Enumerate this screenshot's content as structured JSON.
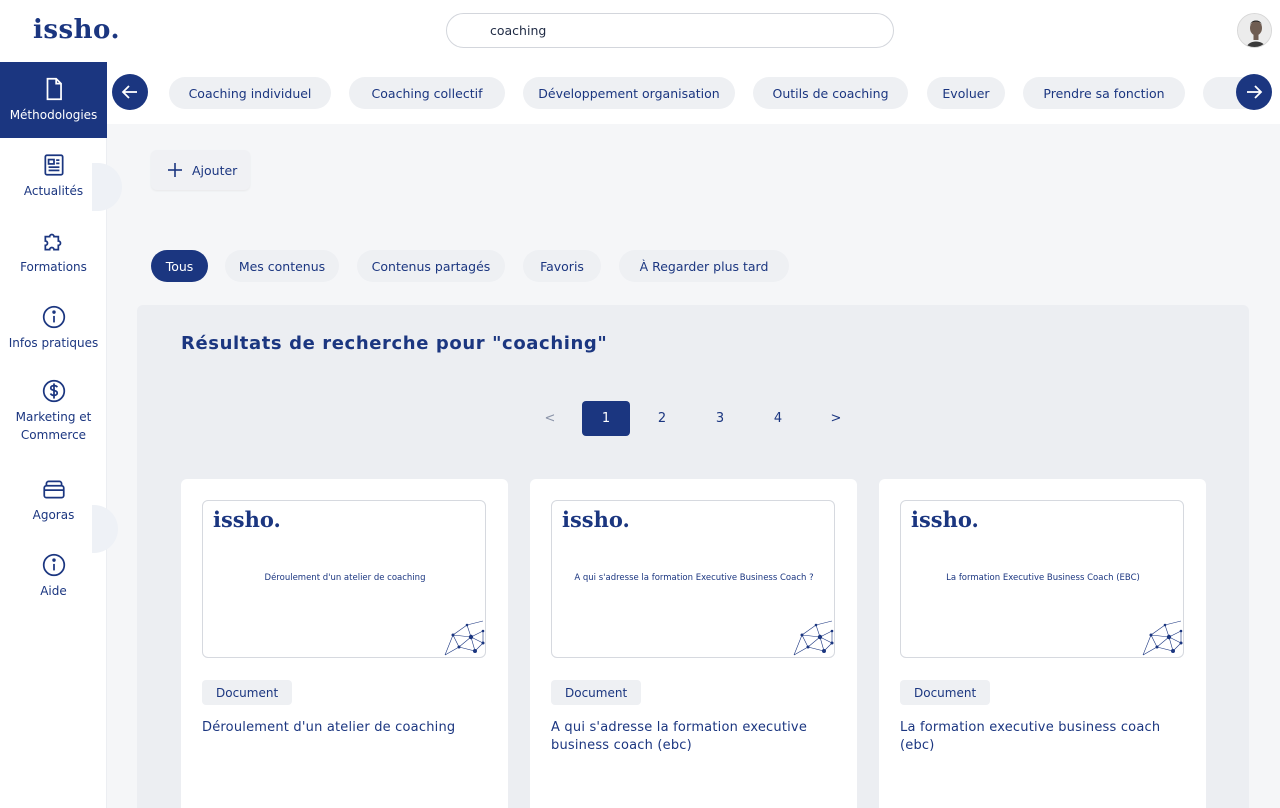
{
  "app": {
    "logo": "issho.",
    "search_value": "coaching"
  },
  "sidebar": {
    "items": [
      {
        "label": "Méthodologies",
        "icon": "document-icon",
        "active": true
      },
      {
        "label": "Actualités",
        "icon": "newspaper-icon",
        "active": false
      },
      {
        "label": "Formations",
        "icon": "puzzle-icon",
        "active": false
      },
      {
        "label": "Infos pratiques",
        "icon": "info-icon",
        "active": false
      },
      {
        "label": "Marketing et Commerce",
        "icon": "dollar-icon",
        "active": false
      },
      {
        "label": "Agoras",
        "icon": "layers-icon",
        "active": false
      },
      {
        "label": "Aide",
        "icon": "info-icon",
        "active": false
      }
    ]
  },
  "categories": [
    "Coaching individuel",
    "Coaching collectif",
    "Développement organisation",
    "Outils de coaching",
    "Evoluer",
    "Prendre sa fonction"
  ],
  "toolbar": {
    "add_label": "Ajouter"
  },
  "filters": [
    {
      "label": "Tous",
      "active": true
    },
    {
      "label": "Mes contenus",
      "active": false
    },
    {
      "label": "Contenus partagés",
      "active": false
    },
    {
      "label": "Favoris",
      "active": false
    },
    {
      "label": "À Regarder plus tard",
      "active": false
    }
  ],
  "results": {
    "title": "Résultats de recherche pour \"coaching\"",
    "pagination": {
      "prev": "<",
      "pages": [
        "1",
        "2",
        "3",
        "4"
      ],
      "current": "1",
      "next": ">"
    },
    "cards": [
      {
        "thumb_logo": "issho.",
        "thumb_text": "Déroulement d'un atelier de coaching",
        "badge": "Document",
        "title": "Déroulement d'un atelier de coaching"
      },
      {
        "thumb_logo": "issho.",
        "thumb_text": "A qui s'adresse la formation Executive Business Coach ?",
        "badge": "Document",
        "title": "A qui s'adresse la formation executive business coach (ebc)"
      },
      {
        "thumb_logo": "issho.",
        "thumb_text": "La formation Executive Business Coach (EBC)",
        "badge": "Document",
        "title": "La formation executive business coach (ebc)"
      }
    ]
  },
  "colors": {
    "brand": "#1b3680",
    "background": "#f5f6f8",
    "pill": "#eef0f3"
  }
}
